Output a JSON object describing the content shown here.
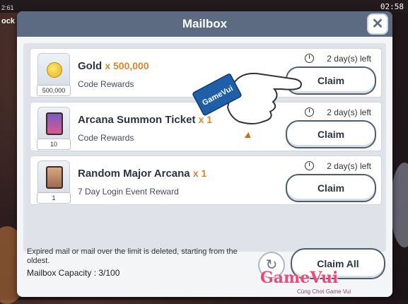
{
  "background": {
    "clock": "02:58",
    "left_label": "ock",
    "left_small": "2:61"
  },
  "mailbox": {
    "title": "Mailbox",
    "close_symbol": "✕",
    "items": [
      {
        "icon": "gold-coin-icon",
        "icon_qty": "500,000",
        "title": "Gold",
        "qty": "x 500,000",
        "subtitle": "Code Rewards",
        "time_left": "2 day(s) left",
        "claim_label": "Claim"
      },
      {
        "icon": "arcana-ticket-icon",
        "icon_qty": "10",
        "title": "Arcana Summon Ticket",
        "qty": "x 1",
        "subtitle": "Code Rewards",
        "time_left": "2 day(s) left",
        "claim_label": "Claim"
      },
      {
        "icon": "major-arcana-card-icon",
        "icon_qty": "1",
        "title": "Random Major Arcana",
        "qty": "x 1",
        "subtitle": "7 Day Login Event Reward",
        "time_left": "2 day(s) left",
        "claim_label": "Claim"
      }
    ],
    "footer_note": "Expired mail or mail over the limit is deleted, starting from the oldest.",
    "capacity_label": "Mailbox Capacity : 3/100",
    "refresh_symbol": "↻",
    "claim_all_label": "Claim All"
  },
  "watermark": {
    "hand_label": "GameVui",
    "logo": "GameVui",
    "tagline": "Cùng Chơi Game Vui"
  },
  "colors": {
    "header": "#5c6a82",
    "accent_qty": "#d7862e",
    "watermark": "#e84b7a"
  }
}
